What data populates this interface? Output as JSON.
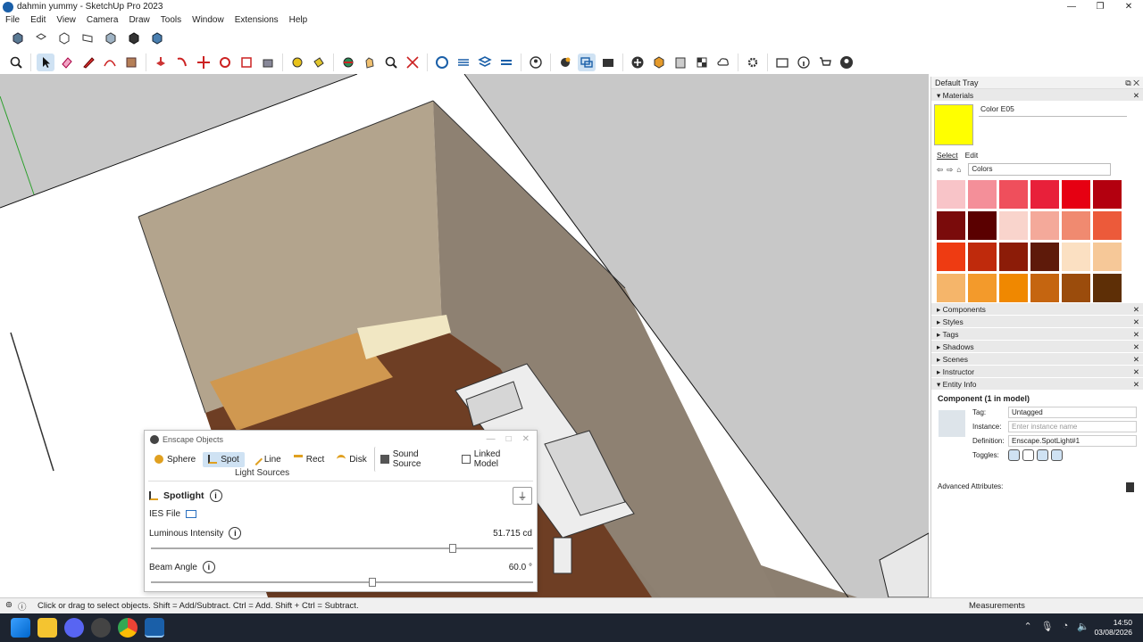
{
  "window": {
    "title": "dahmin yummy - SketchUp Pro 2023",
    "controls": [
      "—",
      "❐",
      "✕"
    ]
  },
  "menu": [
    "File",
    "Edit",
    "View",
    "Camera",
    "Draw",
    "Tools",
    "Window",
    "Extensions",
    "Help"
  ],
  "toolbar_icons": [
    "iso-view-icon",
    "top-view-icon",
    "front-view-icon",
    "right-view-icon",
    "xray-icon",
    "shaded-icon",
    "textured-icon",
    "monochrome-icon"
  ],
  "enscape": {
    "title": "Enscape Objects",
    "tabs": [
      "Sphere",
      "Spot",
      "Line",
      "Rect",
      "Disk",
      "Sound Source",
      "Linked Model"
    ],
    "active_tab": "Spot",
    "section_label": "Light Sources",
    "object_title": "Spotlight",
    "ies_label": "IES File",
    "intensity_label": "Luminous Intensity",
    "intensity_value": "51.715 cd",
    "intensity_fraction": 0.79,
    "beam_label": "Beam Angle",
    "beam_value": "60.0 °",
    "beam_fraction": 0.58
  },
  "tray": {
    "title": "Default Tray",
    "materials": {
      "header": "Materials",
      "material_name": "Color E05",
      "select_label": "Select",
      "edit_label": "Edit",
      "library": "Colors",
      "swatches": [
        "#f8c4c8",
        "#f48f99",
        "#ef4f5c",
        "#e8203a",
        "#e60012",
        "#b3000f",
        "#7a0b0b",
        "#5a0000",
        "#f9d4cc",
        "#f4a99a",
        "#f08a70",
        "#ec5a3a",
        "#ee3b12",
        "#bf2a0c",
        "#8c1c08",
        "#5e1a0a",
        "#fbe0c2",
        "#f6c898",
        "#f5b56a",
        "#f39a2b",
        "#f08800",
        "#c56510",
        "#9b4c0c",
        "#5e2f06"
      ]
    },
    "sections": [
      "Components",
      "Styles",
      "Tags",
      "Shadows",
      "Scenes",
      "Instructor"
    ],
    "entity_info": {
      "header": "Entity Info",
      "title": "Component (1 in model)",
      "tag_label": "Tag:",
      "tag_value": "Untagged",
      "instance_label": "Instance:",
      "instance_placeholder": "Enter instance name",
      "definition_label": "Definition:",
      "definition_value": "Enscape.SpotLight#1",
      "toggles_label": "Toggles:",
      "advanced_label": "Advanced Attributes:"
    }
  },
  "status": {
    "hint": "Click or drag to select objects. Shift = Add/Subtract. Ctrl = Add. Shift + Ctrl = Subtract.",
    "measurements_label": "Measurements"
  },
  "taskbar": {
    "time": "14:50",
    "date": "03/08/2026"
  }
}
